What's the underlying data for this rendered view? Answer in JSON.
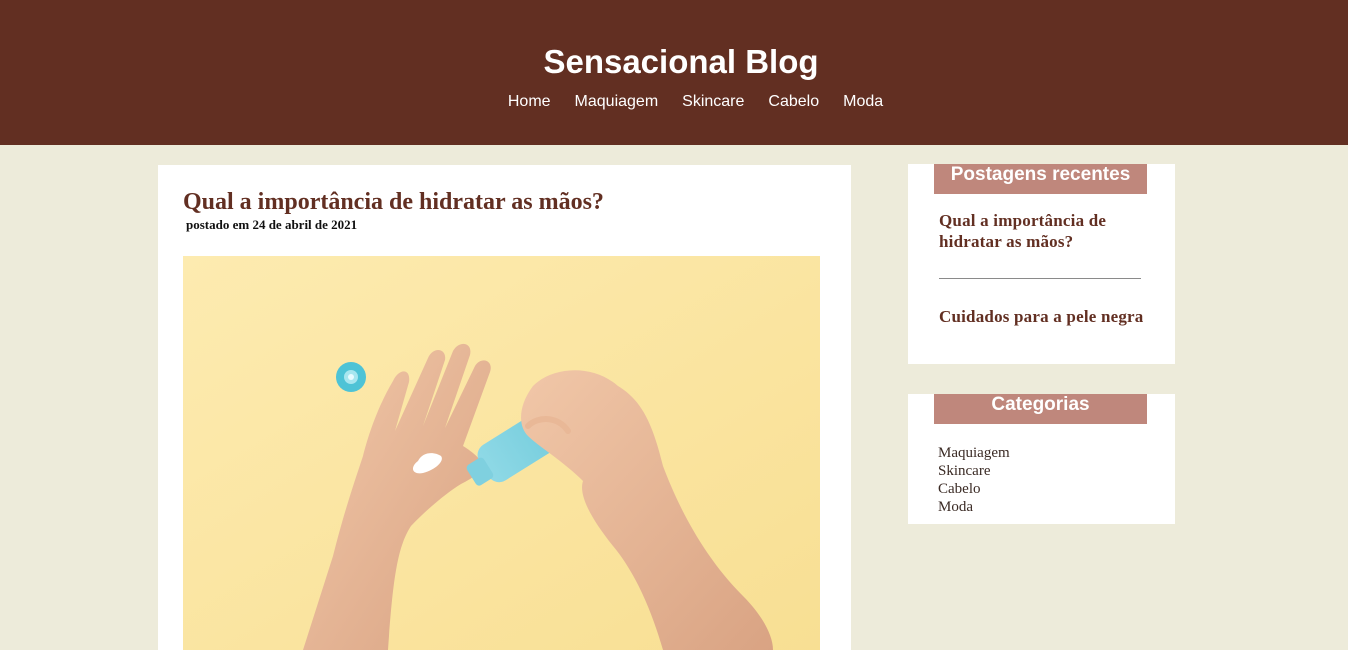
{
  "header": {
    "title": "Sensacional Blog",
    "nav": [
      "Home",
      "Maquiagem",
      "Skincare",
      "Cabelo",
      "Moda"
    ]
  },
  "post": {
    "title": "Qual a importância de hidratar as mãos?",
    "date": "postado em 24 de abril de 2021"
  },
  "recent": {
    "title": "Postagens recentes",
    "items": [
      "Qual a importância de hidratar as mãos?",
      "Cuidados para a pele negra"
    ]
  },
  "categories": {
    "title": "Categorias",
    "items": [
      "Maquiagem",
      "Skincare",
      "Cabelo",
      "Moda"
    ]
  },
  "colors": {
    "header_bg": "#622f22",
    "page_bg": "#edebda",
    "widget_title_bg": "#bf877c",
    "accent_text": "#622f22"
  }
}
